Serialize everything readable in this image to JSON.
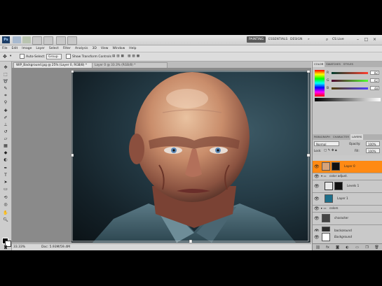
{
  "app": {
    "logo": "Ps",
    "workspaces": [
      "PAINTING",
      "ESSENTIALS",
      "DESIGN",
      "»"
    ],
    "active_workspace": "PAINTING",
    "cs_live": "CS Live"
  },
  "menu": [
    "File",
    "Edit",
    "Image",
    "Layer",
    "Select",
    "Filter",
    "Analysis",
    "3D",
    "View",
    "Window",
    "Help"
  ],
  "options": {
    "auto_select_label": "Auto-Select:",
    "auto_select_value": "Group",
    "show_transform_label": "Show Transform Controls"
  },
  "tabs": [
    {
      "label": "WIP_Background.jpg @ 25% (Layer 0, RGB/8) *",
      "active": true
    },
    {
      "label": "Layer 0 @ 33.3% (RGB/8) *",
      "active": false
    }
  ],
  "status": {
    "zoom": "33.33%",
    "doc_info": "Doc: 5.93M/59.4M"
  },
  "color_panel": {
    "tabs": [
      "COLOR",
      "SWATCHES",
      "STYLES"
    ],
    "R": "82",
    "G": "62",
    "B": "48"
  },
  "layers_panel": {
    "tabs": [
      "PARAGRAPH",
      "CHARACTER",
      "LAYERS"
    ],
    "blend_mode": "Normal",
    "opacity_label": "Opacity:",
    "opacity": "100%",
    "lock_label": "Lock:",
    "fill_label": "Fill:",
    "fill": "100%",
    "layers": [
      {
        "name": "Layer 0",
        "selected": true,
        "thumb": "#d6a37a",
        "mask": true
      },
      {
        "name": "color adjust.",
        "selected": false,
        "thumb": "#777",
        "group": true
      },
      {
        "name": "Levels 1",
        "selected": false,
        "thumb": "#ffffff",
        "mask": true
      },
      {
        "name": "Layer 1",
        "selected": false,
        "thumb": "#1e6f8a",
        "mask": false
      },
      {
        "name": "colors",
        "selected": false,
        "thumb": "#888",
        "group": true
      },
      {
        "name": "character",
        "selected": false,
        "thumb": "#444",
        "mask": false
      },
      {
        "name": "background",
        "selected": false,
        "thumb": "#2c2c2c",
        "mask": false
      },
      {
        "name": "Background",
        "selected": false,
        "thumb": "#ffffff",
        "mask": false
      }
    ]
  },
  "colors": {
    "accent": "#ff8a14",
    "ui_bg": "#d4d4d4"
  }
}
